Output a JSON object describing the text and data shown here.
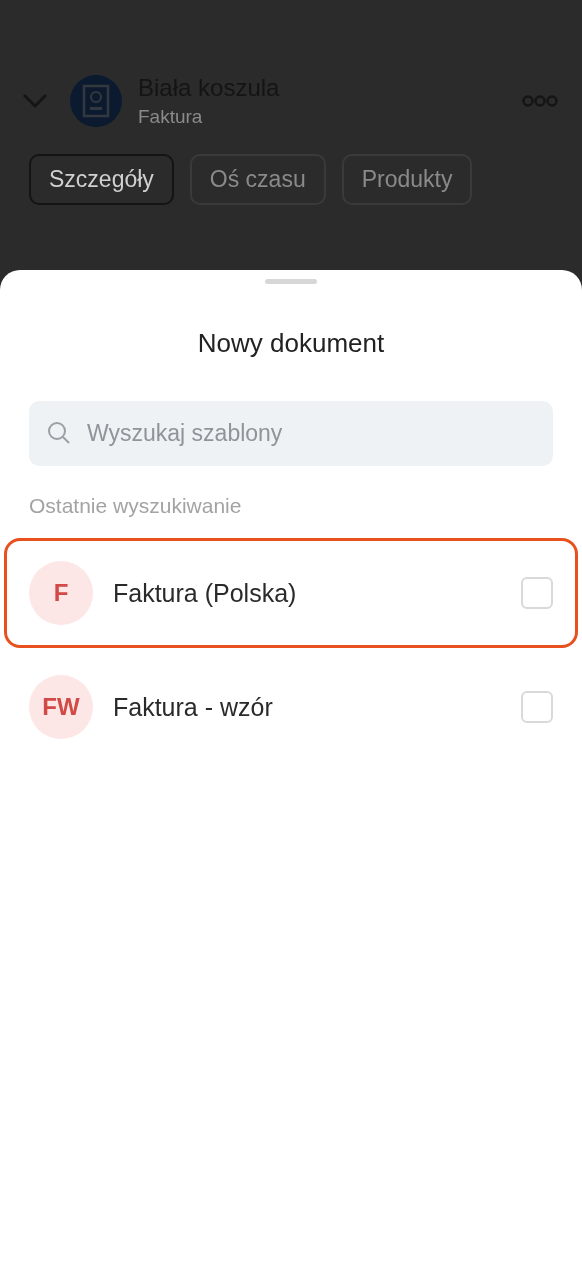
{
  "background": {
    "title": "Biała koszula",
    "subtitle": "Faktura",
    "tabs": [
      {
        "label": "Szczegóły",
        "selected": true
      },
      {
        "label": "Oś czasu",
        "selected": false
      },
      {
        "label": "Produkty",
        "selected": false
      }
    ]
  },
  "sheet": {
    "title": "Nowy dokument",
    "search": {
      "placeholder": "Wyszukaj szablony"
    },
    "section_label": "Ostatnie wyszukiwanie",
    "templates": [
      {
        "initials": "F",
        "name": "Faktura (Polska)",
        "checked": false,
        "highlighted": true
      },
      {
        "initials": "FW",
        "name": "Faktura - wzór",
        "checked": false,
        "highlighted": false
      }
    ]
  }
}
